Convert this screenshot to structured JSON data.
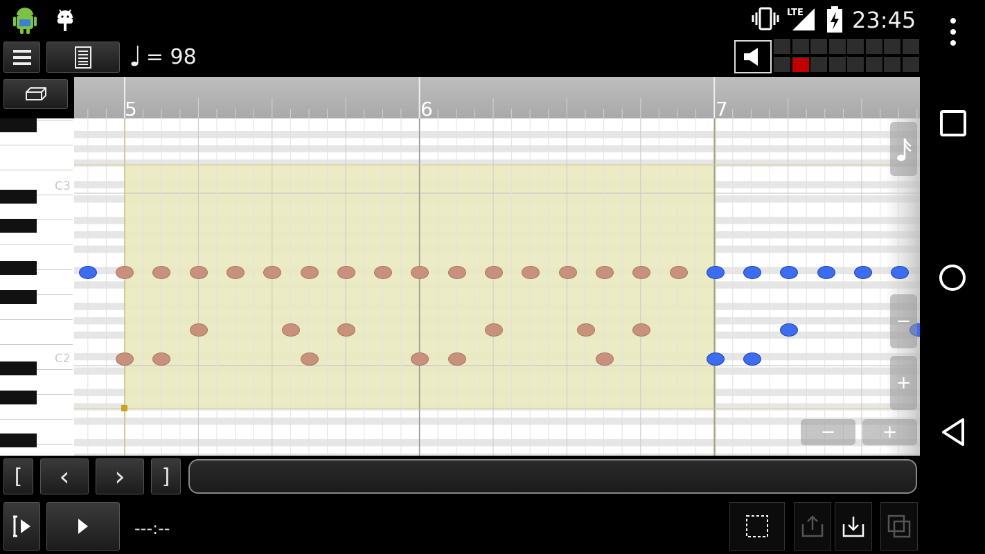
{
  "status_bar": {
    "time": "23:45",
    "icons": [
      "android-mascot-icon",
      "android-debug-icon",
      "vibrate-icon",
      "lte-signal-icon",
      "battery-charging-icon",
      "overflow-menu-icon"
    ],
    "lte_label": "LTE"
  },
  "toolbar": {
    "menu_icon": "hamburger-menu-icon",
    "doc_icon": "document-icon",
    "tempo_symbol": "♩",
    "tempo_value": "= 98",
    "speaker_icon": "speaker-icon"
  },
  "ruler": {
    "bars": [
      "5",
      "6",
      "7"
    ]
  },
  "keyboard": {
    "labels": [
      "C3",
      "C2"
    ]
  },
  "side_buttons": {
    "note_length_icon": "sixteenth-note-icon",
    "zoom_out_v": "−",
    "zoom_in_v": "+",
    "zoom_out_h": "−",
    "zoom_in_h": "+"
  },
  "transport": {
    "bracket_left": "[",
    "prev": "‹",
    "next": "›",
    "bracket_right": "]",
    "time_display": "---:--"
  },
  "colors": {
    "selection": "#e9e9c0",
    "note_selected": "#c8917c",
    "note_normal": "#3c6cf0",
    "meter_active": "#c00000"
  }
}
